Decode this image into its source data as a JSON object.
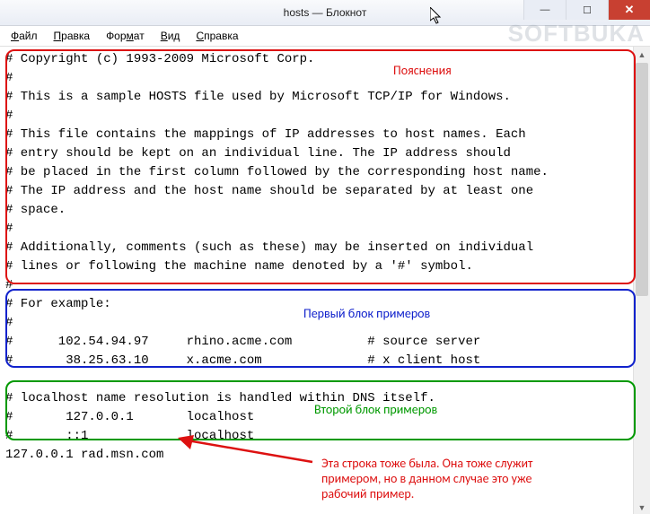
{
  "window": {
    "title": "hosts — Блокнот",
    "watermark": "SOFTBUKA"
  },
  "menubar": {
    "items": [
      {
        "u": "Ф",
        "rest": "айл"
      },
      {
        "u": "П",
        "rest": "равка"
      },
      {
        "u": "",
        "rest": "Фор",
        "u2": "м",
        "rest2": "ат"
      },
      {
        "u": "В",
        "rest": "ид"
      },
      {
        "u": "С",
        "rest": "правка"
      }
    ]
  },
  "win_controls": {
    "min": "—",
    "max": "☐",
    "close": "✕"
  },
  "content": {
    "lines": [
      "# Copyright (c) 1993-2009 Microsoft Corp.",
      "#",
      "# This is a sample HOSTS file used by Microsoft TCP/IP for Windows.",
      "#",
      "# This file contains the mappings of IP addresses to host names. Each",
      "# entry should be kept on an individual line. The IP address should",
      "# be placed in the first column followed by the corresponding host name.",
      "# The IP address and the host name should be separated by at least one",
      "# space.",
      "#",
      "# Additionally, comments (such as these) may be inserted on individual",
      "# lines or following the machine name denoted by a '#' symbol.",
      "#",
      "# For example:",
      "#",
      "#      102.54.94.97     rhino.acme.com          # source server",
      "#       38.25.63.10     x.acme.com              # x client host",
      "",
      "# localhost name resolution is handled within DNS itself.",
      "#       127.0.0.1       localhost",
      "#       ::1             localhost",
      "127.0.0.1 rad.msn.com"
    ]
  },
  "annotations": {
    "a1": "Пояснения",
    "a2": "Первый блок примеров",
    "a3": "Второй блок примеров",
    "a4": "Эта строка тоже была. Она тоже служит\nпримером, но в данном случае это уже\nрабочий пример."
  }
}
